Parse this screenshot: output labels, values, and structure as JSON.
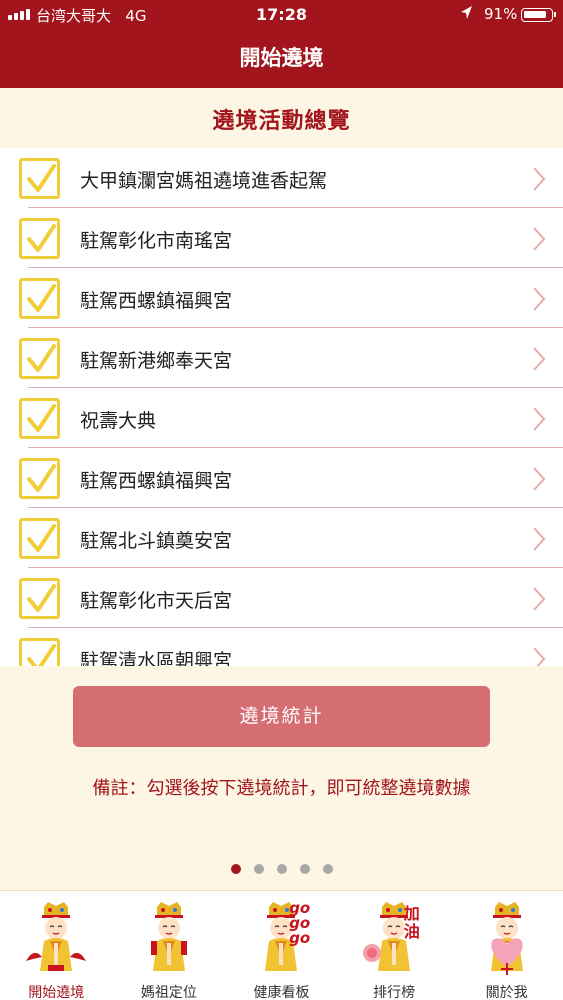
{
  "status_bar": {
    "carrier": "台湾大哥大",
    "network": "4G",
    "time": "17:28",
    "battery": "91%"
  },
  "header": {
    "title": "開始遶境"
  },
  "section": {
    "title": "遶境活動總覽"
  },
  "items": [
    {
      "label": "大甲鎮瀾宮媽祖遶境進香起駕",
      "checked": true
    },
    {
      "label": "駐駕彰化市南瑤宮",
      "checked": true
    },
    {
      "label": "駐駕西螺鎮福興宮",
      "checked": true
    },
    {
      "label": "駐駕新港鄉奉天宮",
      "checked": true
    },
    {
      "label": "祝壽大典",
      "checked": true
    },
    {
      "label": "駐駕西螺鎮福興宮",
      "checked": true
    },
    {
      "label": "駐駕北斗鎮奠安宮",
      "checked": true
    },
    {
      "label": "駐駕彰化市天后宮",
      "checked": true
    },
    {
      "label": "駐駕清水區朝興宮",
      "checked": true
    }
  ],
  "stats_button": {
    "label": "遶境統計"
  },
  "note": "備註：勾選後按下遶境統計，即可統整遶境數據",
  "pager": {
    "count": 5,
    "active": 1
  },
  "tabs": [
    {
      "label": "開始遶境",
      "active": true,
      "badge": ""
    },
    {
      "label": "媽祖定位",
      "active": false,
      "badge": ""
    },
    {
      "label": "健康看板",
      "active": false,
      "badge": "go go go"
    },
    {
      "label": "排行榜",
      "active": false,
      "badge": "加油"
    },
    {
      "label": "關於我",
      "active": false,
      "badge": ""
    }
  ],
  "colors": {
    "brand_red": "#a3151c",
    "background": "#fdf6e4",
    "checkbox": "#f2cd3a",
    "button": "#d46e72",
    "divider": "#e7aeb0"
  },
  "icons": {
    "location": "location-arrow-icon",
    "battery": "battery-icon",
    "signal": "signal-bars-icon",
    "checkbox": "checkmark-icon",
    "row_action": "chevron-right-icon",
    "tab": "mazu-figure-icon"
  }
}
